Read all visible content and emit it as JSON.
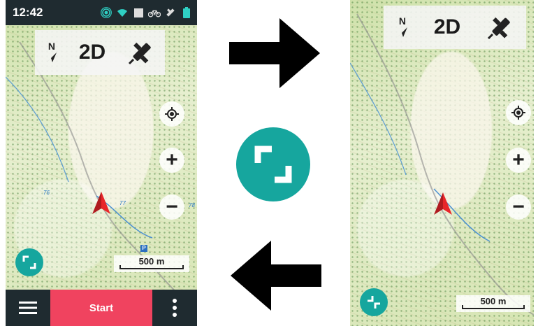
{
  "left_screen": {
    "status": {
      "time": "12:42",
      "icons": [
        "gps-signal-icon",
        "wifi-icon",
        "stop-square-icon",
        "bicycle-icon",
        "satellite-icon",
        "battery-icon"
      ]
    },
    "mode_bar": {
      "north_label": "N",
      "mode_label": "2D",
      "icons": [
        "north-arrow-icon",
        "satellite-dish-icon"
      ]
    },
    "controls": {
      "locate": "locate-icon",
      "zoom_in": "+",
      "zoom_out": "−"
    },
    "scale_label": "500 m",
    "map_labels": {
      "contour_76": "76",
      "contour_77": "77",
      "contour_78": "78",
      "parking": "P"
    },
    "bottom_bar": {
      "start_label": "Start",
      "menu_icon": "hamburger-menu-icon",
      "more_icon": "more-vertical-icon"
    },
    "fullscreen_icon": "expand-icon"
  },
  "right_screen": {
    "mode_bar": {
      "north_label": "N",
      "mode_label": "2D"
    },
    "controls": {
      "locate": "locate-icon",
      "zoom_in": "+",
      "zoom_out": "−"
    },
    "scale_label": "500 m",
    "fullscreen_icon": "collapse-icon"
  },
  "center": {
    "arrow_right_icon": "arrow-right-icon",
    "fullscreen_toggle_icon": "expand-icon",
    "arrow_left_icon": "arrow-left-icon"
  },
  "colors": {
    "accent_teal": "#16a69e",
    "start_red": "#f0435f",
    "bar_dark": "#1f2b30",
    "cursor_red": "#e8262a"
  }
}
